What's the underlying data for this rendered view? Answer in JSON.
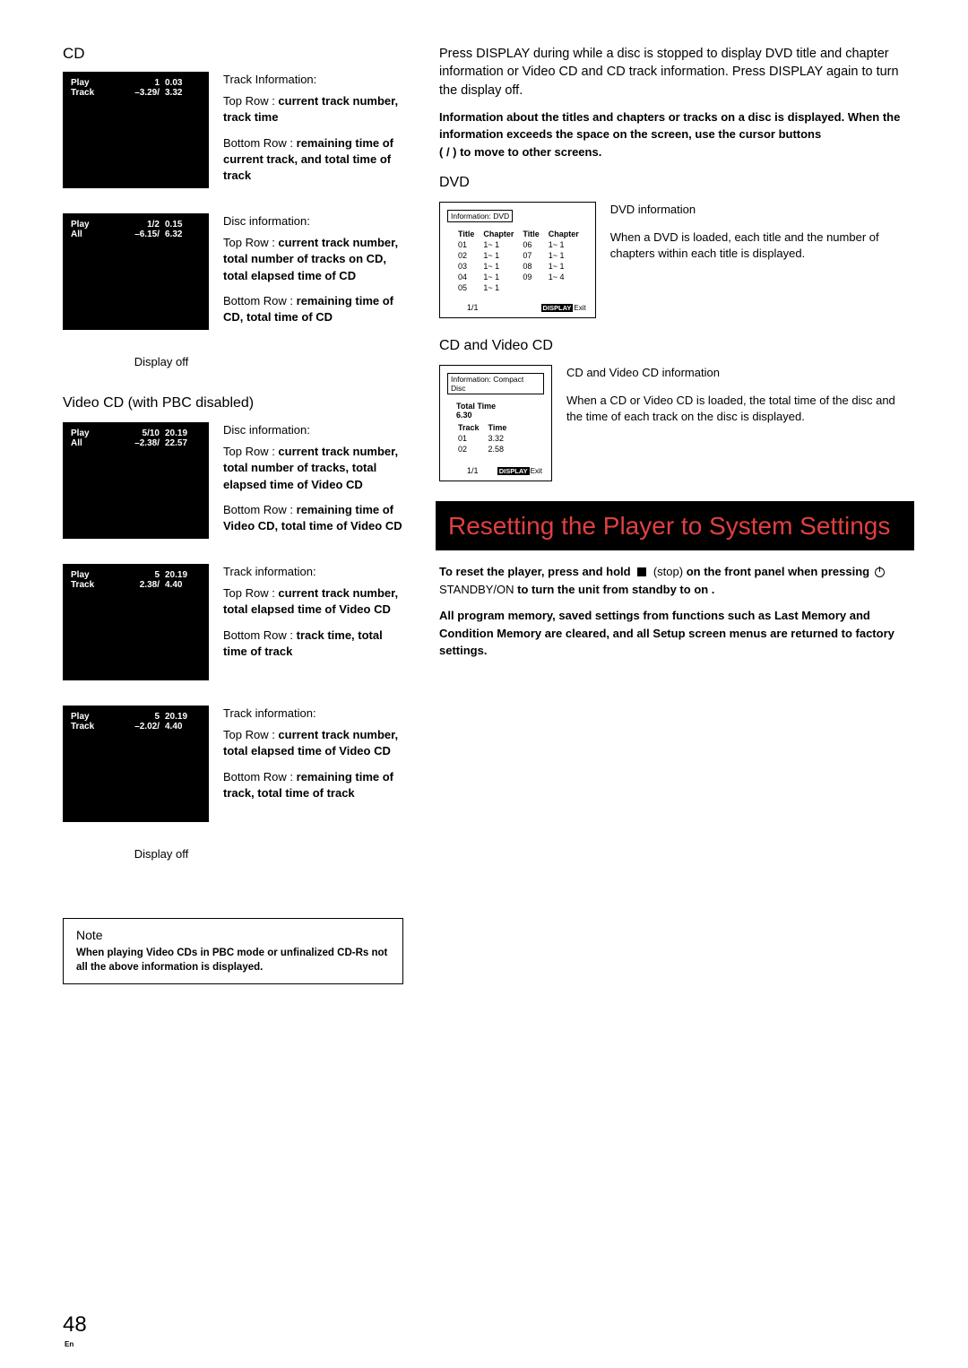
{
  "left": {
    "cd_head": "CD",
    "track_info": {
      "title": "Track Information:",
      "top_label": "Top Row : ",
      "top_bold": "current track number, track time",
      "bottom_label": "Bottom Row : ",
      "bottom_bold": "remaining time of current track, and total time of track",
      "lcd": {
        "l1a": "Play",
        "l1b": "1",
        "l1c": "0.03",
        "l2a": "Track",
        "l2b": "–3.29/",
        "l2c": "3.32"
      }
    },
    "disc_info_cd": {
      "title": "Disc information:",
      "top_label": "Top Row : ",
      "top_bold": "current track number, total number of tracks on CD, total elapsed time of CD",
      "bottom_label": "Bottom Row : ",
      "bottom_bold": "remaining time of CD, total time of CD",
      "lcd": {
        "l1a": "Play",
        "l1b": "1/2",
        "l1c": "0.15",
        "l2a": "All",
        "l2b": "–6.15/",
        "l2c": "6.32"
      }
    },
    "display_off": "Display off",
    "vcd_head": "Video CD (with PBC disabled)",
    "vcd_disc": {
      "title": "Disc information:",
      "top_label": "Top Row : ",
      "top_bold": "current track number, total number of tracks, total elapsed time of Video CD",
      "bottom_label": "Bottom Row : ",
      "bottom_bold": "remaining time of Video CD, total time of Video CD",
      "lcd": {
        "l1a": "Play",
        "l1b": "5/10",
        "l1c": "20.19",
        "l2a": "All",
        "l2b": "–2.38/",
        "l2c": "22.57"
      }
    },
    "vcd_track1": {
      "title": "Track information:",
      "top_label": "Top Row : ",
      "top_bold": "current track number, total elapsed time of Video CD",
      "bottom_label": "Bottom Row : ",
      "bottom_bold": "track time, total time of track",
      "lcd": {
        "l1a": "Play",
        "l1b": "5",
        "l1c": "20.19",
        "l2a": "Track",
        "l2b": "2.38/",
        "l2c": "4.40"
      }
    },
    "vcd_track2": {
      "title": "Track information:",
      "top_label": "Top Row : ",
      "top_bold": "current track number, total elapsed time of Video CD",
      "bottom_label": "Bottom Row : ",
      "bottom_bold": "remaining time of track, total time of track",
      "lcd": {
        "l1a": "Play",
        "l1b": "5",
        "l1c": "20.19",
        "l2a": "Track",
        "l2b": "–2.02/",
        "l2c": "4.40"
      }
    },
    "note_head": "Note",
    "note_body": "When playing Video CDs in PBC mode or unfinalized CD-Rs not all the above information is displayed."
  },
  "right": {
    "p1": "Press DISPLAY during while a disc is stopped to display DVD title and chapter information or Video CD and CD track information. Press DISPLAY again to turn the display off.",
    "p2": "Information about the titles and chapters or tracks on a disc is displayed. When the information exceeds the space on the screen, use the cursor buttons",
    "p2b": "(    /    ) to move to other screens.",
    "dvd_head": "DVD",
    "dvd_box": {
      "title": "Information: DVD",
      "hdr": [
        "Title",
        "Chapter",
        "Title",
        "Chapter"
      ],
      "rows": [
        [
          "01",
          "1~ 1",
          "06",
          "1~ 1"
        ],
        [
          "02",
          "1~ 1",
          "07",
          "1~ 1"
        ],
        [
          "03",
          "1~ 1",
          "08",
          "1~ 1"
        ],
        [
          "04",
          "1~ 1",
          "09",
          "1~ 4"
        ],
        [
          "05",
          "1~ 1",
          "",
          ""
        ]
      ],
      "page": "1/1",
      "display": "DISPLAY",
      "exit": "Exit"
    },
    "dvd_desc_head": "DVD information",
    "dvd_desc": "When a DVD is loaded, each title and the number of chapters within each title is displayed.",
    "cdvcd_head": "CD and Video CD",
    "cd_box": {
      "title": "Information: Compact Disc",
      "total_label": "Total Time",
      "total_val": "6.30",
      "hdr": [
        "Track",
        "Time"
      ],
      "rows": [
        [
          "01",
          "3.32"
        ],
        [
          "02",
          "2.58"
        ]
      ],
      "page": "1/1",
      "display": "DISPLAY",
      "exit": "Exit"
    },
    "cd_desc_head": "CD and Video CD information",
    "cd_desc": "When a CD or Video CD is loaded, the total time of the disc and the time of each track on the disc  is displayed.",
    "banner": "Resetting the Player to System Settings",
    "reset1a": "To reset the player, press and hold ",
    "reset1b": "(stop)",
    "reset1c": " on the front panel when pressing ",
    "reset1d": " STANDBY/ON ",
    "reset1e": "to turn the unit from standby to on .",
    "reset2": "All program memory, saved settings from functions such as Last Memory and Condition Memory are cleared, and all Setup screen menus are returned to factory settings."
  },
  "page": "48",
  "lang": "En"
}
